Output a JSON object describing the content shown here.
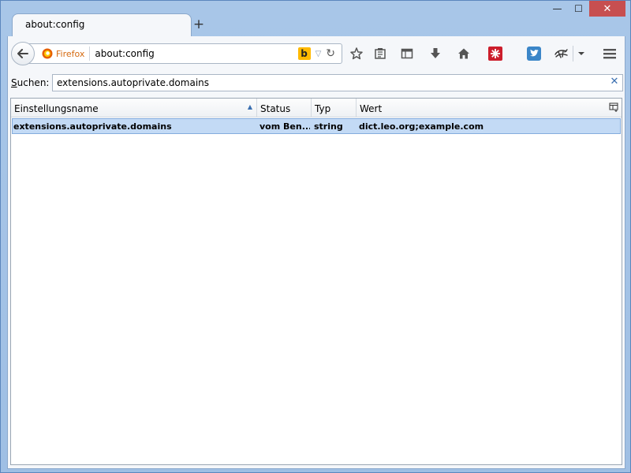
{
  "window": {
    "minimize": "—",
    "maximize": "☐",
    "close": "✕"
  },
  "tab": {
    "title": "about:config",
    "new_tab": "+"
  },
  "navbar": {
    "identity_label": "Firefox",
    "url": "about:config",
    "search_engine_letter": "b"
  },
  "search": {
    "label_prefix": "S",
    "label_rest": "uchen:",
    "value": "extensions.autoprivate.domains",
    "clear": "✕"
  },
  "table": {
    "columns": [
      {
        "label": "Einstellungsname"
      },
      {
        "label": "Status"
      },
      {
        "label": "Typ"
      },
      {
        "label": "Wert"
      }
    ],
    "rows": [
      {
        "name": "extensions.autoprivate.domains",
        "status": "vom Ben...",
        "type": "string",
        "value": "dict.leo.org;example.com"
      }
    ]
  },
  "colors": {
    "accent": "#3a6fb0",
    "selection": "#c3daf5",
    "close_button": "#c74f50",
    "identity": "#d56a10",
    "lastpass": "#cc1e2c",
    "twitter": "#3b86c8"
  },
  "icons": [
    "back-arrow-icon",
    "firefox-icon",
    "bing-icon",
    "dropdown-icon",
    "reload-icon",
    "bookmark-star-icon",
    "reading-list-icon",
    "sidebar-icon",
    "download-icon",
    "home-icon",
    "lastpass-icon",
    "twitter-icon",
    "extension-icon",
    "menu-icon"
  ]
}
